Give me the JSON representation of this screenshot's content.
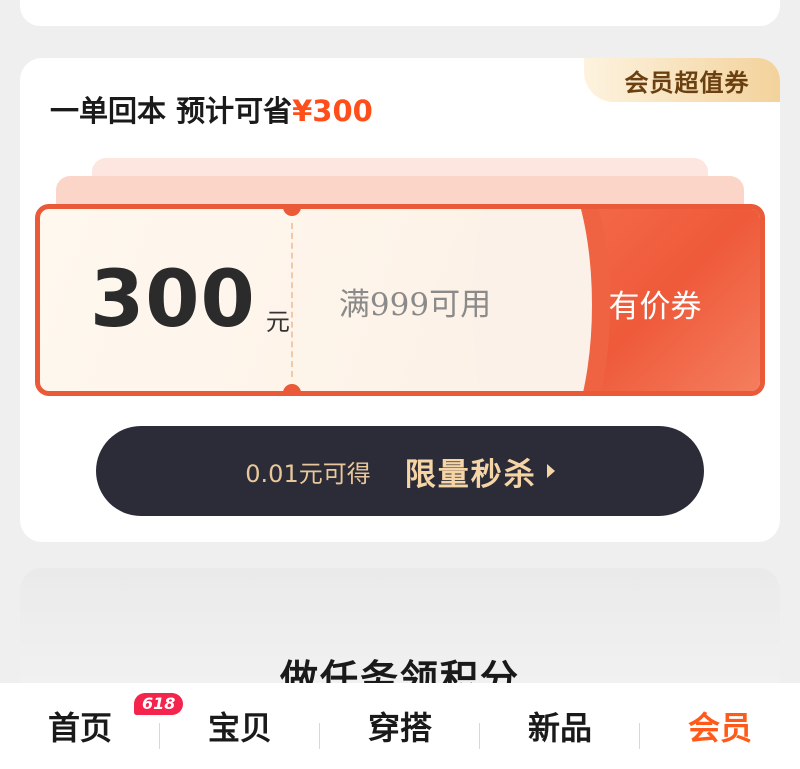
{
  "coupon_card": {
    "badge": "会员超值券",
    "headline_prefix": "一单回本 预计可省",
    "headline_amount": "¥300",
    "ticket": {
      "amount": "300",
      "unit": "元",
      "condition": "满999可用",
      "type": "有价券"
    },
    "flash_sale": {
      "price_text": "0.01元可得",
      "label": "限量秒杀",
      "arrow_icon": "caret-right-icon"
    }
  },
  "task_section": {
    "title": "做任务领积分"
  },
  "tabbar": {
    "active_color": "#ff5a1a",
    "badge_text": "618",
    "tabs": [
      {
        "label": "首页"
      },
      {
        "label": "宝贝"
      },
      {
        "label": "穿搭"
      },
      {
        "label": "新品"
      },
      {
        "label": "会员"
      }
    ]
  },
  "colors": {
    "accent": "#ff4e1a",
    "ticket_border": "#ea5a38",
    "button_bg": "#2b2c38",
    "button_text": "#f5d4a6"
  }
}
